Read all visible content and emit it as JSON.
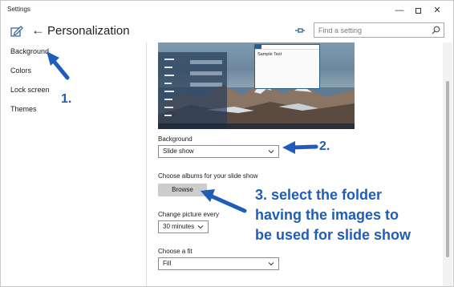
{
  "window": {
    "title": "Settings",
    "min_label": "—",
    "close_label": "✕"
  },
  "header": {
    "back_glyph": "←",
    "title": "Personalization",
    "search_placeholder": "Find a setting"
  },
  "sidebar": {
    "items": [
      {
        "label": "Background"
      },
      {
        "label": "Colors"
      },
      {
        "label": "Lock screen"
      },
      {
        "label": "Themes"
      }
    ]
  },
  "preview": {
    "sample_text": "Sample Text"
  },
  "settings": {
    "background_label": "Background",
    "background_value": "Slide show",
    "albums_label": "Choose albums for your slide show",
    "browse_label": "Browse",
    "change_label": "Change picture every",
    "change_value": "30 minutes",
    "fit_label": "Choose a fit",
    "fit_value": "Fill"
  },
  "annotations": {
    "step1": "1.",
    "step2": "2.",
    "step3_lines": [
      "3. select the folder",
      "having the images to",
      "be used for slide show"
    ]
  },
  "colors": {
    "accent": "#1f5db8",
    "window_border": "#2b5e8c",
    "browse_bg": "#cccccc"
  },
  "icons": [
    "edit-icon",
    "back-arrow-icon",
    "pin-icon",
    "search-icon",
    "chevron-down-icon",
    "minimize-icon",
    "maximize-icon",
    "close-icon"
  ]
}
